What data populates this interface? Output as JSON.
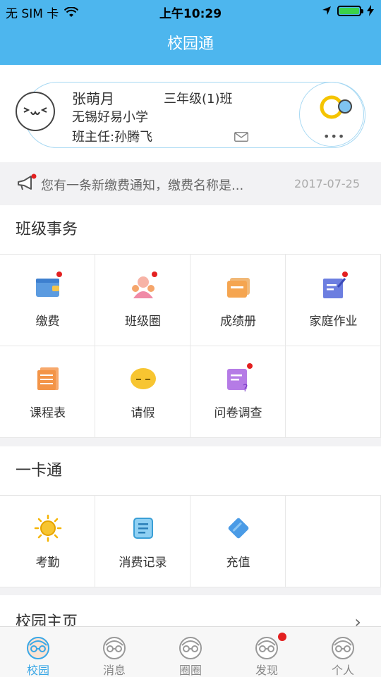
{
  "status_bar": {
    "carrier": "无 SIM 卡",
    "time": "上午10:29",
    "battery_level": 1.0,
    "battery_color": "#3ad24a"
  },
  "nav": {
    "title": "校园通",
    "background": "#4db6ee"
  },
  "profile": {
    "name": "张萌月",
    "class": "三年级(1)班",
    "school": "无锡好易小学",
    "teacher": "班主任:孙腾飞",
    "avatar_icon": "smiley-face-icon",
    "more": "•••"
  },
  "notice": {
    "text": "您有一条新缴费通知，缴费名称是...",
    "date": "2017-07-25"
  },
  "class_affairs": {
    "title": "班级事务",
    "items": [
      {
        "label": "缴费",
        "icon": "wallet-icon",
        "badge": true
      },
      {
        "label": "班级圈",
        "icon": "class-circle-icon",
        "badge": true
      },
      {
        "label": "成绩册",
        "icon": "gradebook-icon",
        "badge": false
      },
      {
        "label": "家庭作业",
        "icon": "homework-icon",
        "badge": true
      },
      {
        "label": "课程表",
        "icon": "timetable-icon",
        "badge": false
      },
      {
        "label": "请假",
        "icon": "leave-icon",
        "badge": false
      },
      {
        "label": "问卷调查",
        "icon": "survey-icon",
        "badge": true
      }
    ]
  },
  "card": {
    "title": "一卡通",
    "items": [
      {
        "label": "考勤",
        "icon": "attendance-sun-icon"
      },
      {
        "label": "消费记录",
        "icon": "consumption-record-icon"
      },
      {
        "label": "充值",
        "icon": "recharge-card-icon"
      }
    ]
  },
  "homepage": {
    "title": "校园主页",
    "chevron": "›"
  },
  "tabs": [
    {
      "label": "校园",
      "active": true,
      "badge": false
    },
    {
      "label": "消息",
      "active": false,
      "badge": false
    },
    {
      "label": "圈圈",
      "active": false,
      "badge": false
    },
    {
      "label": "发现",
      "active": false,
      "badge": true
    },
    {
      "label": "个人",
      "active": false,
      "badge": false
    }
  ]
}
